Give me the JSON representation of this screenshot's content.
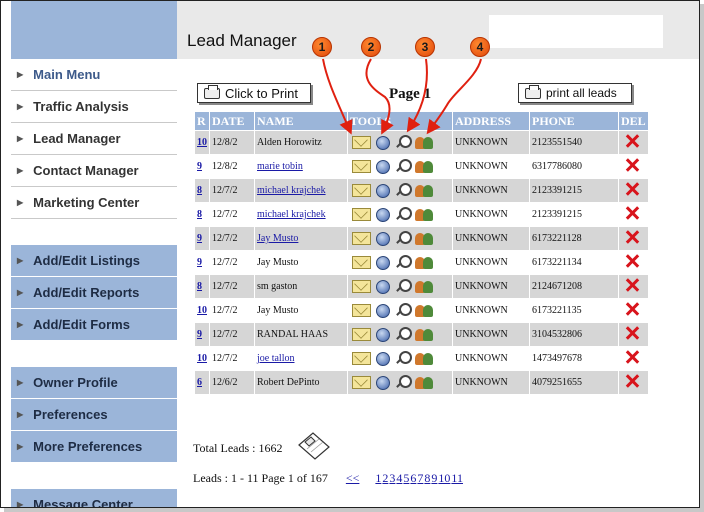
{
  "header": {
    "title": "Lead Manager"
  },
  "sidebar": {
    "items": [
      {
        "label": "Main Menu",
        "style": "white active"
      },
      {
        "label": "Traffic Analysis",
        "style": "white"
      },
      {
        "label": "Lead Manager",
        "style": "white"
      },
      {
        "label": "Contact Manager",
        "style": "white"
      },
      {
        "label": "Marketing Center",
        "style": "white"
      },
      {
        "label": "Add/Edit Listings",
        "style": "blue"
      },
      {
        "label": "Add/Edit Reports",
        "style": "blue"
      },
      {
        "label": "Add/Edit Forms",
        "style": "blue"
      },
      {
        "label": "Owner Profile",
        "style": "blue"
      },
      {
        "label": "Preferences",
        "style": "blue"
      },
      {
        "label": "More Preferences",
        "style": "blue"
      },
      {
        "label": "Message Center",
        "style": "blue"
      }
    ]
  },
  "toolbar": {
    "print_label": "Click to Print",
    "print_all_label": "print all leads"
  },
  "page_label": "Page 1",
  "callouts": [
    "1",
    "2",
    "3",
    "4"
  ],
  "table": {
    "headers": {
      "r": "R",
      "date": "DATE",
      "name": "NAME",
      "tools": "TOOLS",
      "address": "ADDRESS",
      "phone": "PHONE",
      "del": "DEL"
    },
    "rows": [
      {
        "r": "10",
        "date": "12/8/2",
        "name": "Alden Horowitz",
        "name_link": false,
        "address": "UNKNOWN",
        "phone": "2123551540"
      },
      {
        "r": "9",
        "date": "12/8/2",
        "name": "marie tobin",
        "name_link": true,
        "address": "UNKNOWN",
        "phone": "6317786080"
      },
      {
        "r": "8",
        "date": "12/7/2",
        "name": "michael krajchek",
        "name_link": true,
        "address": "UNKNOWN",
        "phone": "2123391215"
      },
      {
        "r": "8",
        "date": "12/7/2",
        "name": "michael krajchek",
        "name_link": true,
        "address": "UNKNOWN",
        "phone": "2123391215"
      },
      {
        "r": "9",
        "date": "12/7/2",
        "name": "Jay Musto",
        "name_link": true,
        "address": "UNKNOWN",
        "phone": "6173221128"
      },
      {
        "r": "9",
        "date": "12/7/2",
        "name": "Jay Musto",
        "name_link": false,
        "address": "UNKNOWN",
        "phone": "6173221134"
      },
      {
        "r": "8",
        "date": "12/7/2",
        "name": "sm gaston",
        "name_link": false,
        "address": "UNKNOWN",
        "phone": "2124671208"
      },
      {
        "r": "10",
        "date": "12/7/2",
        "name": "Jay Musto",
        "name_link": false,
        "address": "UNKNOWN",
        "phone": "6173221135"
      },
      {
        "r": "9",
        "date": "12/7/2",
        "name": "RANDAL HAAS",
        "name_link": false,
        "address": "UNKNOWN",
        "phone": "3104532806"
      },
      {
        "r": "10",
        "date": "12/7/2",
        "name": "joe tallon",
        "name_link": true,
        "address": "UNKNOWN",
        "phone": "1473497678"
      },
      {
        "r": "6",
        "date": "12/6/2",
        "name": "Robert DePinto",
        "name_link": false,
        "address": "UNKNOWN",
        "phone": "4079251655"
      }
    ]
  },
  "totals": {
    "label": "Total Leads : 1662"
  },
  "pagination": {
    "summary": "Leads : 1 - 11 Page 1 of 167",
    "prev": "<<",
    "pages": [
      "1",
      "2",
      "3",
      "4",
      "5",
      "6",
      "7",
      "8",
      "9",
      "10",
      "11"
    ]
  },
  "colors": {
    "accent_blue": "#9bb5d9",
    "callout_orange": "#e0460a",
    "arrow_red": "#e02010",
    "link_blue": "#1a1aa6"
  }
}
